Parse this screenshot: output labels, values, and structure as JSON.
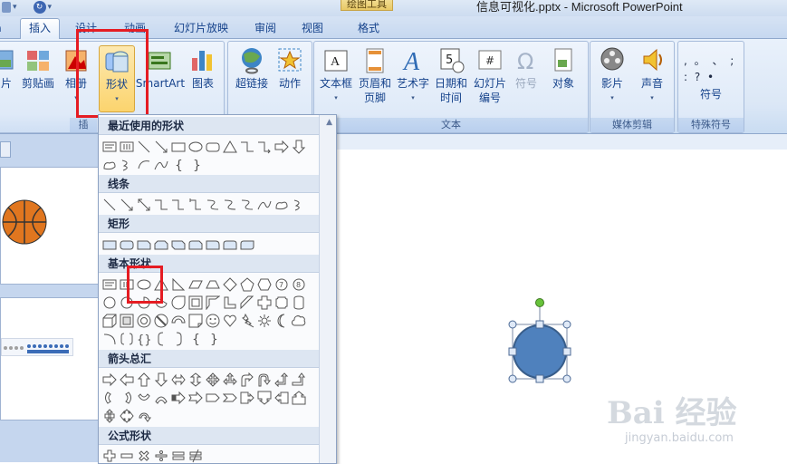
{
  "window": {
    "context_tab": "绘图工具",
    "title": "信息可视化.pptx - Microsoft PowerPoint",
    "qat_icon": "redo-icon"
  },
  "tabs": [
    "插入",
    "设计",
    "动画",
    "幻灯片放映",
    "审阅",
    "视图",
    "格式"
  ],
  "active_tab": "插入",
  "ribbon": {
    "illustrations": {
      "label": "插",
      "buttons": {
        "picture": "片",
        "clipart": "剪贴画",
        "photo_album": "相册",
        "shapes": "形状",
        "smartart": "SmartArt",
        "chart": "图表"
      }
    },
    "links": {
      "hyperlink": "超链接",
      "action": "动作"
    },
    "text": {
      "label": "文本",
      "textbox": "文本框",
      "header_footer_1": "页眉和",
      "header_footer_2": "页脚",
      "wordart": "艺术字",
      "datetime_1": "日期和",
      "datetime_2": "时间",
      "slide_number_1": "幻灯片",
      "slide_number_2": "编号",
      "symbol": "符号",
      "object": "对象"
    },
    "media": {
      "label": "媒体剪辑",
      "movie": "影片",
      "sound": "声音"
    },
    "special": {
      "label": "特殊符号",
      "symbol": "符号",
      "glyphs": ", 。 、 ; : ? •"
    }
  },
  "gallery": {
    "categories": [
      "最近使用的形状",
      "线条",
      "矩形",
      "基本形状",
      "箭头总汇",
      "公式形状"
    ]
  },
  "watermark": {
    "brand": "Bai 经验",
    "url": "jingyan.baidu.com"
  },
  "colors": {
    "accent_red": "#e51c23",
    "shape_fill": "#4f81bd",
    "handle_green": "#67c23a"
  }
}
